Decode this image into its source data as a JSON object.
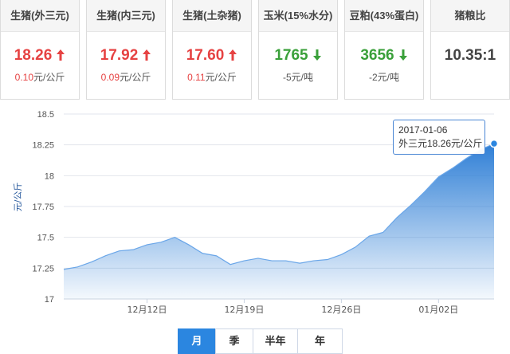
{
  "cards": [
    {
      "title": "生猪(外三元)",
      "price": "18.26",
      "change": "0.10元/公斤",
      "trend": "up"
    },
    {
      "title": "生猪(内三元)",
      "price": "17.92",
      "change": "0.09元/公斤",
      "trend": "up"
    },
    {
      "title": "生猪(土杂猪)",
      "price": "17.60",
      "change": "0.11元/公斤",
      "trend": "up"
    },
    {
      "title": "玉米(15%水分)",
      "price": "1765",
      "change": "-5元/吨",
      "trend": "down"
    },
    {
      "title": "豆粕(43%蛋白)",
      "price": "3656",
      "change": "-2元/吨",
      "trend": "down"
    },
    {
      "title": "猪粮比",
      "price": "10.35:1",
      "change": "",
      "trend": "neutral"
    }
  ],
  "colors": {
    "up": "#e64242",
    "down": "#3aa03a",
    "accent": "#2b86e0"
  },
  "chart_data": {
    "type": "area",
    "ylabel": "元/公斤",
    "ylim": [
      17,
      18.5
    ],
    "yticks": [
      "18.5",
      "18.25",
      "18",
      "17.75",
      "17.5",
      "17.25",
      "17"
    ],
    "ytick_values": [
      18.5,
      18.25,
      18,
      17.75,
      17.5,
      17.25,
      17
    ],
    "xticks": [
      "12月12日",
      "12月19日",
      "12月26日",
      "01月02日"
    ],
    "xtick_index": [
      6,
      13,
      20,
      27
    ],
    "series": [
      {
        "name": "外三元",
        "x": [
          "2016-12-06",
          "2016-12-07",
          "2016-12-08",
          "2016-12-09",
          "2016-12-10",
          "2016-12-11",
          "2016-12-12",
          "2016-12-13",
          "2016-12-14",
          "2016-12-15",
          "2016-12-16",
          "2016-12-17",
          "2016-12-18",
          "2016-12-19",
          "2016-12-20",
          "2016-12-21",
          "2016-12-22",
          "2016-12-23",
          "2016-12-24",
          "2016-12-25",
          "2016-12-26",
          "2016-12-27",
          "2016-12-28",
          "2016-12-29",
          "2016-12-30",
          "2016-12-31",
          "2017-01-01",
          "2017-01-02",
          "2017-01-03",
          "2017-01-04",
          "2017-01-05",
          "2017-01-06"
        ],
        "values": [
          17.24,
          17.26,
          17.3,
          17.35,
          17.39,
          17.4,
          17.44,
          17.46,
          17.5,
          17.44,
          17.37,
          17.35,
          17.28,
          17.31,
          17.33,
          17.31,
          17.31,
          17.29,
          17.31,
          17.32,
          17.36,
          17.42,
          17.51,
          17.54,
          17.66,
          17.76,
          17.87,
          17.99,
          18.06,
          18.14,
          18.21,
          18.26
        ]
      }
    ],
    "tooltip": {
      "date": "2017-01-06",
      "text": "外三元18.26元/公斤"
    },
    "grid": "horizontal",
    "legend": "none"
  },
  "tabs": [
    {
      "label": "月",
      "active": true
    },
    {
      "label": "季",
      "active": false
    },
    {
      "label": "半年",
      "active": false
    },
    {
      "label": "年",
      "active": false
    }
  ]
}
